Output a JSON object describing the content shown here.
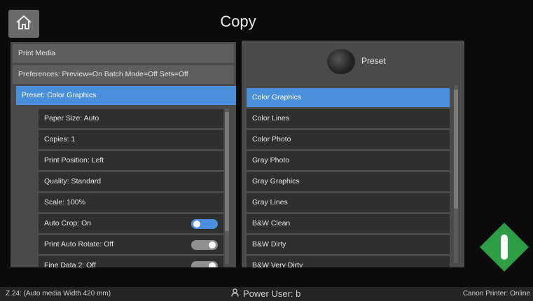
{
  "header": {
    "title": "Copy",
    "home_icon": "home-icon"
  },
  "left_panel": {
    "print_media": "Print Media",
    "preferences": "Preferences: Preview=On Batch Mode=Off Sets=Off",
    "preset_selected": "Preset: Color Graphics",
    "settings": [
      "Paper Size: Auto",
      "Copies: 1",
      "Print Position: Left",
      "Quality: Standard",
      "Scale: 100%",
      "Auto Crop: On",
      "Print Auto Rotate: Off",
      "Fine Data 2: Off"
    ],
    "toggles": {
      "auto_crop": true,
      "print_auto_rotate": false,
      "third": false
    }
  },
  "right_panel": {
    "preset_label": "Preset",
    "items": [
      "Color Graphics",
      "Color Lines",
      "Color Photo",
      "Gray Photo",
      "Gray Graphics",
      "Gray Lines",
      "B&W Clean",
      "B&W Dirty",
      "B&W Very Dirty"
    ],
    "selected_index": 0
  },
  "status_bar": {
    "left": "Z 24: (Auto media Width 420 mm)",
    "user": "Power User: b",
    "right": "Canon Printer: Online"
  },
  "colors": {
    "accent": "#4a8fdb",
    "start": "#2e9e46"
  }
}
